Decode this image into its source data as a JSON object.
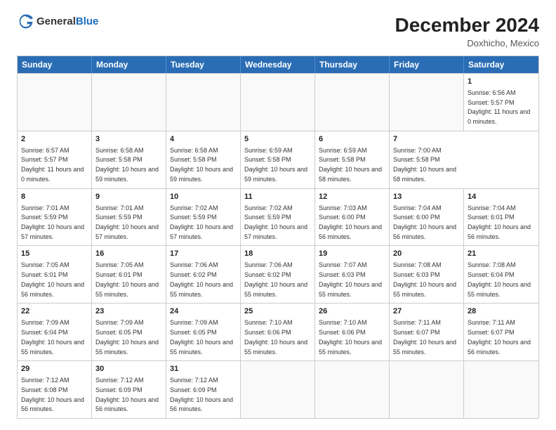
{
  "header": {
    "logo_general": "General",
    "logo_blue": "Blue",
    "month_title": "December 2024",
    "location": "Doxhicho, Mexico"
  },
  "calendar": {
    "days_of_week": [
      "Sunday",
      "Monday",
      "Tuesday",
      "Wednesday",
      "Thursday",
      "Friday",
      "Saturday"
    ],
    "weeks": [
      [
        {
          "day": "",
          "empty": true
        },
        {
          "day": "",
          "empty": true
        },
        {
          "day": "",
          "empty": true
        },
        {
          "day": "",
          "empty": true
        },
        {
          "day": "",
          "empty": true
        },
        {
          "day": "",
          "empty": true
        },
        {
          "day": "1",
          "rise": "6:56 AM",
          "set": "5:57 PM",
          "daylight": "11 hours and 0 minutes."
        }
      ],
      [
        {
          "day": "2",
          "rise": "6:57 AM",
          "set": "5:57 PM",
          "daylight": "11 hours and 0 minutes."
        },
        {
          "day": "3",
          "rise": "6:58 AM",
          "set": "5:58 PM",
          "daylight": "10 hours and 59 minutes."
        },
        {
          "day": "4",
          "rise": "6:58 AM",
          "set": "5:58 PM",
          "daylight": "10 hours and 59 minutes."
        },
        {
          "day": "5",
          "rise": "6:59 AM",
          "set": "5:58 PM",
          "daylight": "10 hours and 59 minutes."
        },
        {
          "day": "6",
          "rise": "6:59 AM",
          "set": "5:58 PM",
          "daylight": "10 hours and 58 minutes."
        },
        {
          "day": "7",
          "rise": "7:00 AM",
          "set": "5:58 PM",
          "daylight": "10 hours and 58 minutes."
        }
      ],
      [
        {
          "day": "8",
          "rise": "7:01 AM",
          "set": "5:59 PM",
          "daylight": "10 hours and 57 minutes."
        },
        {
          "day": "9",
          "rise": "7:01 AM",
          "set": "5:59 PM",
          "daylight": "10 hours and 57 minutes."
        },
        {
          "day": "10",
          "rise": "7:02 AM",
          "set": "5:59 PM",
          "daylight": "10 hours and 57 minutes."
        },
        {
          "day": "11",
          "rise": "7:02 AM",
          "set": "5:59 PM",
          "daylight": "10 hours and 57 minutes."
        },
        {
          "day": "12",
          "rise": "7:03 AM",
          "set": "6:00 PM",
          "daylight": "10 hours and 56 minutes."
        },
        {
          "day": "13",
          "rise": "7:04 AM",
          "set": "6:00 PM",
          "daylight": "10 hours and 56 minutes."
        },
        {
          "day": "14",
          "rise": "7:04 AM",
          "set": "6:01 PM",
          "daylight": "10 hours and 56 minutes."
        }
      ],
      [
        {
          "day": "15",
          "rise": "7:05 AM",
          "set": "6:01 PM",
          "daylight": "10 hours and 56 minutes."
        },
        {
          "day": "16",
          "rise": "7:05 AM",
          "set": "6:01 PM",
          "daylight": "10 hours and 55 minutes."
        },
        {
          "day": "17",
          "rise": "7:06 AM",
          "set": "6:02 PM",
          "daylight": "10 hours and 55 minutes."
        },
        {
          "day": "18",
          "rise": "7:06 AM",
          "set": "6:02 PM",
          "daylight": "10 hours and 55 minutes."
        },
        {
          "day": "19",
          "rise": "7:07 AM",
          "set": "6:03 PM",
          "daylight": "10 hours and 55 minutes."
        },
        {
          "day": "20",
          "rise": "7:08 AM",
          "set": "6:03 PM",
          "daylight": "10 hours and 55 minutes."
        },
        {
          "day": "21",
          "rise": "7:08 AM",
          "set": "6:04 PM",
          "daylight": "10 hours and 55 minutes."
        }
      ],
      [
        {
          "day": "22",
          "rise": "7:09 AM",
          "set": "6:04 PM",
          "daylight": "10 hours and 55 minutes."
        },
        {
          "day": "23",
          "rise": "7:09 AM",
          "set": "6:05 PM",
          "daylight": "10 hours and 55 minutes."
        },
        {
          "day": "24",
          "rise": "7:09 AM",
          "set": "6:05 PM",
          "daylight": "10 hours and 55 minutes."
        },
        {
          "day": "25",
          "rise": "7:10 AM",
          "set": "6:06 PM",
          "daylight": "10 hours and 55 minutes."
        },
        {
          "day": "26",
          "rise": "7:10 AM",
          "set": "6:06 PM",
          "daylight": "10 hours and 55 minutes."
        },
        {
          "day": "27",
          "rise": "7:11 AM",
          "set": "6:07 PM",
          "daylight": "10 hours and 55 minutes."
        },
        {
          "day": "28",
          "rise": "7:11 AM",
          "set": "6:07 PM",
          "daylight": "10 hours and 56 minutes."
        }
      ],
      [
        {
          "day": "29",
          "rise": "7:12 AM",
          "set": "6:08 PM",
          "daylight": "10 hours and 56 minutes."
        },
        {
          "day": "30",
          "rise": "7:12 AM",
          "set": "6:09 PM",
          "daylight": "10 hours and 56 minutes."
        },
        {
          "day": "31",
          "rise": "7:12 AM",
          "set": "6:09 PM",
          "daylight": "10 hours and 56 minutes."
        },
        {
          "day": "",
          "empty": true
        },
        {
          "day": "",
          "empty": true
        },
        {
          "day": "",
          "empty": true
        },
        {
          "day": "",
          "empty": true
        }
      ]
    ]
  }
}
